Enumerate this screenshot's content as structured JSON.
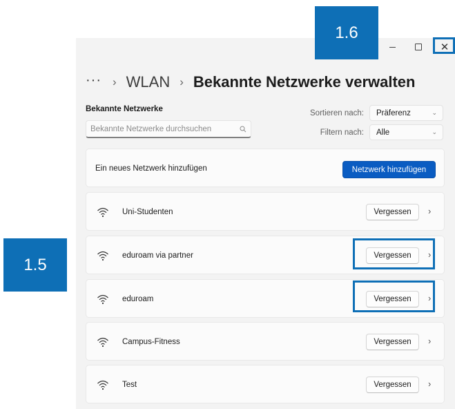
{
  "window": {
    "close_glyph": "✕"
  },
  "breadcrumb": {
    "more": "···",
    "separator": "›",
    "parent": "WLAN",
    "current": "Bekannte Netzwerke verwalten"
  },
  "known_networks": {
    "title": "Bekannte Netzwerke",
    "search_placeholder": "Bekannte Netzwerke durchsuchen",
    "sort_label": "Sortieren nach:",
    "sort_value": "Präferenz",
    "filter_label": "Filtern nach:",
    "filter_value": "Alle"
  },
  "add_network": {
    "label": "Ein neues Netzwerk hinzufügen",
    "button": "Netzwerk hinzufügen"
  },
  "networks": [
    {
      "name": "Uni-Studenten",
      "action": "Vergessen"
    },
    {
      "name": "eduroam via partner",
      "action": "Vergessen"
    },
    {
      "name": "eduroam",
      "action": "Vergessen"
    },
    {
      "name": "Campus-Fitness",
      "action": "Vergessen"
    },
    {
      "name": "Test",
      "action": "Vergessen"
    }
  ],
  "annotations": {
    "step_window": "1.6",
    "step_forget": "1.5"
  },
  "colors": {
    "accent": "#0a5cc2",
    "annotation": "#0e6fb6",
    "window_bg": "#f3f3f3",
    "card_bg": "#fbfbfb"
  }
}
